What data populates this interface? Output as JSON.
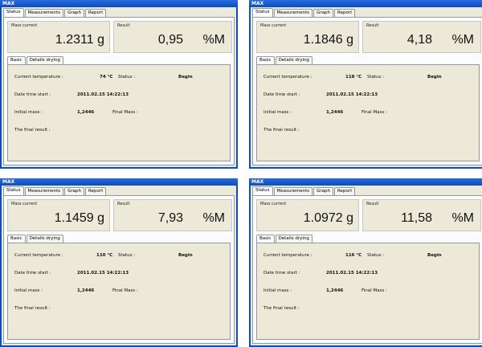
{
  "panels": [
    {
      "title": "MAX",
      "tabs": [
        "Status",
        "Measurements",
        "Graph",
        "Report"
      ],
      "mass_label": "Mass current",
      "mass_value": "1.2311 g",
      "result_label": "Result",
      "result_value": "0,95",
      "result_unit": "%M",
      "subtabs": [
        "Basic",
        "Details drying"
      ],
      "current_temperature_label": "Current temperature :",
      "current_temperature": "74 °C",
      "status_label": "Status :",
      "status": "Begin",
      "date_label": "Date time start :",
      "date": "2011.02.15 14:22:13",
      "initial_mass_label": "Initial mass :",
      "initial_mass": "1,2446",
      "final_mass_label": "Final Mass :",
      "final_result_label": "The final result :"
    },
    {
      "title": "MAX",
      "tabs": [
        "Status",
        "Measurements",
        "Graph",
        "Report"
      ],
      "mass_label": "Mass current",
      "mass_value": "1.1846 g",
      "result_label": "Result",
      "result_value": "4,18",
      "result_unit": "%M",
      "subtabs": [
        "Basic",
        "Details drying"
      ],
      "current_temperature_label": "Current temperature :",
      "current_temperature": "118 °C",
      "status_label": "Status :",
      "status": "Begin",
      "date_label": "Date time start :",
      "date": "2011.02.15 14:22:13",
      "initial_mass_label": "Initial mass :",
      "initial_mass": "1,2446",
      "final_mass_label": "Final Mass :",
      "final_result_label": "The final result :"
    },
    {
      "title": "MAX",
      "tabs": [
        "Status",
        "Measurements",
        "Graph",
        "Report"
      ],
      "mass_label": "Mass current",
      "mass_value": "1.1459 g",
      "result_label": "Result",
      "result_value": "7,93",
      "result_unit": "%M",
      "subtabs": [
        "Basic",
        "Details drying"
      ],
      "current_temperature_label": "Current temperature :",
      "current_temperature": "110 °C",
      "status_label": "Status :",
      "status": "Begin",
      "date_label": "Date time start :",
      "date": "2011.02.15 14:22:13",
      "initial_mass_label": "Initial mass :",
      "initial_mass": "1,2446",
      "final_mass_label": "Final Mass :",
      "final_result_label": "The final result :"
    },
    {
      "title": "MAX",
      "tabs": [
        "Status",
        "Measurements",
        "Graph",
        "Report"
      ],
      "mass_label": "Mass current",
      "mass_value": "1.0972 g",
      "result_label": "Result",
      "result_value": "11,58",
      "result_unit": "%M",
      "subtabs": [
        "Basic",
        "Details drying"
      ],
      "current_temperature_label": "Current temperature :",
      "current_temperature": "116 °C",
      "status_label": "Status :",
      "status": "Begin",
      "date_label": "Date time start :",
      "date": "2011.02.15 14:22:13",
      "initial_mass_label": "Initial mass :",
      "initial_mass": "1,2446",
      "final_mass_label": "Final Mass :",
      "final_result_label": "The final result :"
    }
  ]
}
